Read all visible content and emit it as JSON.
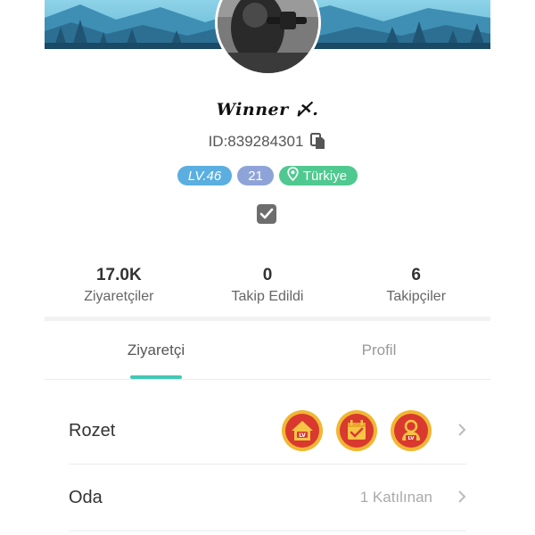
{
  "profile": {
    "username": "Winner 〆.",
    "id_label": "ID:839284301",
    "badges": {
      "level": "LV.46",
      "age": "21",
      "country": "Türkiye"
    }
  },
  "stats": [
    {
      "value": "17.0K",
      "label": "Ziyaretçiler"
    },
    {
      "value": "0",
      "label": "Takip Edildi"
    },
    {
      "value": "6",
      "label": "Takipçiler"
    }
  ],
  "tabs": [
    {
      "label": "Ziyaretçi",
      "active": true
    },
    {
      "label": "Profil",
      "active": false
    }
  ],
  "rows": {
    "rozet": {
      "title": "Rozet",
      "icons": [
        "house-level-medal-icon",
        "calendar-check-medal-icon",
        "person-level-medal-icon"
      ]
    },
    "oda": {
      "title": "Oda",
      "value": "1 Katılınan"
    }
  },
  "colors": {
    "level_badge": "#5aaee0",
    "age_badge": "#8ea4d8",
    "country_badge": "#4fc98f",
    "tab_indicator": "#42c8b4",
    "medal_red": "#d9392f",
    "medal_gold": "#f2b632"
  },
  "icons": {
    "copy": "copy-icon",
    "location": "location-pin-icon",
    "verify": "checkbox-check-icon",
    "chevron": "chevron-right-icon"
  }
}
